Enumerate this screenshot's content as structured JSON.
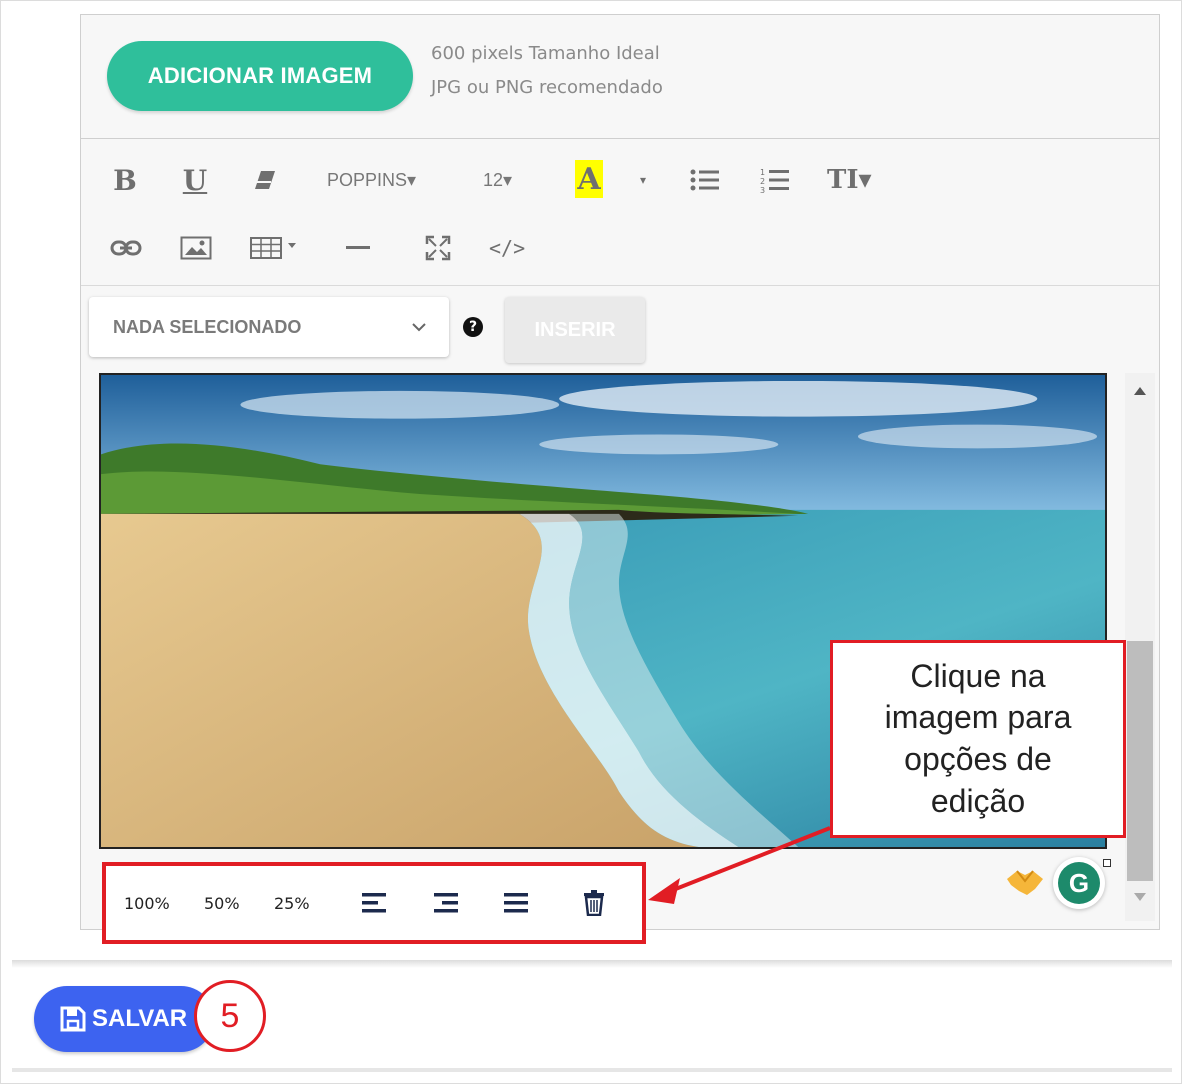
{
  "upload": {
    "add_image_label": "ADICIONAR IMAGEM",
    "hint_size": "600 pixels Tamanho Ideal",
    "hint_format": "JPG ou PNG recomendado"
  },
  "toolbar": {
    "bold": "B",
    "underline": "U",
    "font_family": "POPPINS▾",
    "font_size": "12▾",
    "color_letter": "A",
    "color_caret": "▾",
    "line_height": "TI▾",
    "code": "</>"
  },
  "insert": {
    "select_value": "NADA SELECIONADO",
    "help": "?",
    "insert_label": "INSERIR"
  },
  "image_popover": {
    "resize_100": "100%",
    "resize_50": "50%",
    "resize_25": "25%"
  },
  "callout": {
    "text": "Clique na imagem para opções de edição"
  },
  "footer": {
    "save_label": "SALVAR",
    "step_number": "5"
  },
  "colors": {
    "add_image": "#2fbf9b",
    "save": "#3d63f0",
    "annotation": "#e11d24",
    "highlight": "#ffff00"
  }
}
